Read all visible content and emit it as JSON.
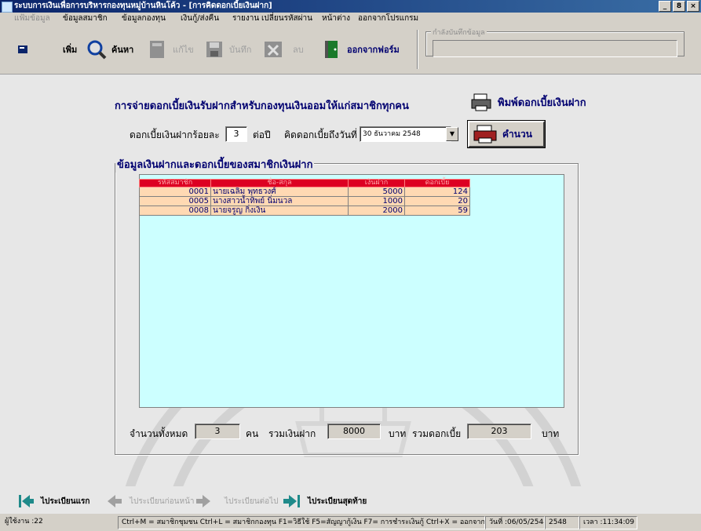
{
  "window": {
    "title": "ระบบการเงินเพื่อการบริหารกองทุนหมู่บ้านหินโค้ว - [การคิดดอกเบี้ยเงินฝาก]",
    "buttons": [
      "_",
      "8",
      "×"
    ]
  },
  "menu": {
    "items": [
      "แฟ้มข้อมูล",
      "ข้อมูลสมาชิก",
      "ข้อมูลกองทุน",
      "เงินกู้/ส่งคืน",
      "รายงาน",
      "เปลี่ยนรหัสผ่าน",
      "หน้าต่าง",
      "ออกจากโปรแกรม"
    ]
  },
  "toolbar": {
    "add": "เพิ่ม",
    "search": "ค้นหา",
    "edit": "แก้ไข",
    "save": "บันทึก",
    "delete": "ลบ",
    "exit_form": "ออกจากฟอร์ม",
    "status_group_label": "กำลังบันทึกข้อมูล"
  },
  "form": {
    "heading": "การจ่ายดอกเบี้ยเงินรับฝากสำหรับกองทุนเงินออมให้แก่สมาชิกทุกคน",
    "print_label": "พิมพ์ดอกเบี้ยเงินฝาก",
    "rate_label": "ดอกเบี้ยเงินฝากร้อยละ",
    "rate_value": "3",
    "per_year": "ต่อปี",
    "calc_date_label": "คิดดอกเบี้ยถึงวันที่",
    "calc_date": "30  ธันวาคม   2548",
    "calc_button": "คำนวน",
    "section_label": "ข้อมูลเงินฝากและดอกเบี้ยของสมาชิกเงินฝาก"
  },
  "table": {
    "columns": [
      "รหัสสมาชิก",
      "ชื่อ-สกุล",
      "เงินฝาก",
      "ดอกเบี้ย"
    ],
    "rows": [
      [
        "0001",
        "นายเฉลิม พุทธวงศ์",
        "5000",
        "124"
      ],
      [
        "0005",
        "นางสาวน้ำทิพย์ นิ่มนวล",
        "1000",
        "20"
      ],
      [
        "0008",
        "นายจรูญ กิ่งเงิน",
        "2000",
        "59"
      ]
    ]
  },
  "summary": {
    "count_label": "จำนวนทั้งหมด",
    "count": "3",
    "count_unit": "คน",
    "deposit_label": "รวมเงินฝาก",
    "deposit_total": "8000",
    "deposit_unit": "บาท",
    "interest_label": "รวมดอกเบี้ย",
    "interest_total": "203",
    "interest_unit": "บาท"
  },
  "navigation": {
    "first": "ไประเบียนแรก",
    "prev": "ไประเบียนก่อนหน้า",
    "next": "ไประเบียนต่อไป",
    "last": "ไประเบียนสุดท้าย"
  },
  "statusbar": {
    "user": "ผู้ใช้งาน :22",
    "shortcuts": "Ctrl+M = สมาชิกชุมชน   Ctrl+L = สมาชิกกองทุน   F1=วิธีใช้   F5=สัญญากู้เงิน   F7= การชำระเงินกู้   Ctrl+X = ออกจากโปรแกรม",
    "date": "วันที่ :06/05/2548",
    "year": "2548",
    "time": "เวลา :11:34:09"
  }
}
